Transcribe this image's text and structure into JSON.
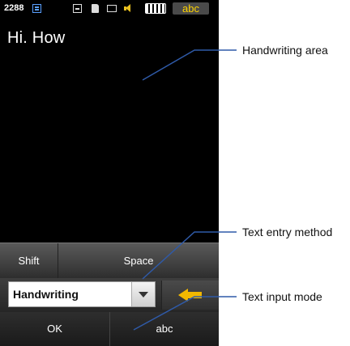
{
  "status_bar": {
    "count": "2288",
    "mode_badge": "abc",
    "icons": [
      "e-icon",
      "network-icon",
      "sd-card-icon",
      "message-icon",
      "volume-icon",
      "battery-icon"
    ],
    "badge_color": "#ffd400"
  },
  "text_field": {
    "typed_text": "Hi. How"
  },
  "keyboard": {
    "shift_label": "Shift",
    "space_label": "Space",
    "entry_method_value": "Handwriting",
    "input_mode_icon": "left-arrow-icon",
    "ok_label": "OK",
    "abc_label": "abc",
    "accent_color": "#f2b800"
  },
  "callouts": {
    "handwriting_area": "Handwriting area",
    "text_entry_method": "Text entry method",
    "text_input_mode": "Text input mode"
  }
}
